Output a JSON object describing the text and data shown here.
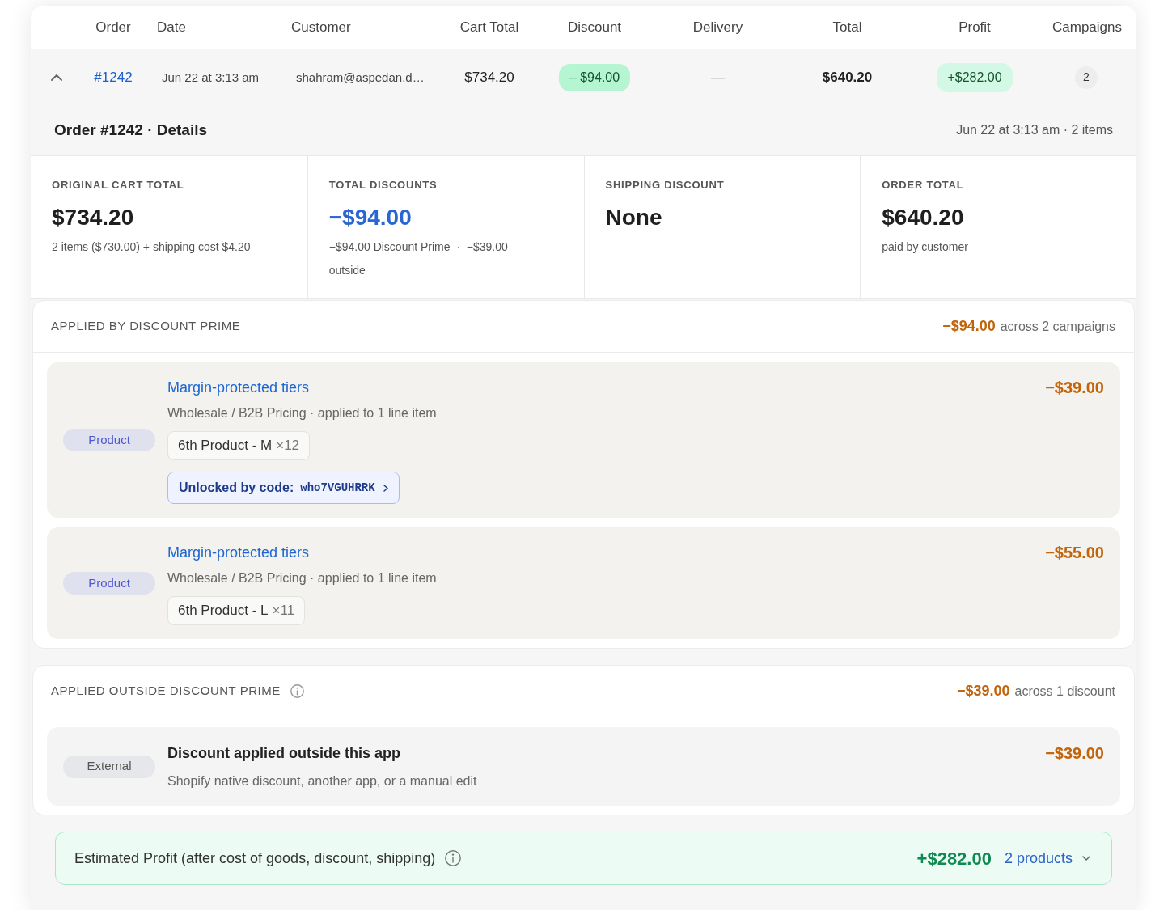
{
  "table": {
    "columns": [
      "Order",
      "Date",
      "Customer",
      "Cart Total",
      "Discount",
      "Delivery",
      "Total",
      "Profit",
      "Campaigns"
    ],
    "row": {
      "expanded": true,
      "order": "#1242",
      "date": "Jun 22 at 3:13 am",
      "customer": "shahram@aspedan.d…",
      "cart_total": "$734.20",
      "discount": "– $94.00",
      "delivery": "—",
      "total": "$640.20",
      "profit": "+$282.00",
      "campaigns": "2"
    }
  },
  "details": {
    "title": "Order #1242 · Details",
    "meta": "Jun 22 at 3:13 am · 2 items"
  },
  "summary": [
    {
      "label": "ORIGINAL CART TOTAL",
      "value": "$734.20",
      "highlight": false,
      "note": "2 items ($730.00) + shipping cost $4.20"
    },
    {
      "label": "TOTAL DISCOUNTS",
      "value": "−$94.00",
      "highlight": true,
      "note": "−$94.00 Discount Prime  ·  −$39.00 outside"
    },
    {
      "label": "SHIPPING DISCOUNT",
      "value": "None",
      "highlight": false
    },
    {
      "label": "ORDER TOTAL",
      "value": "$640.20",
      "highlight": false,
      "note": "paid by customer"
    }
  ],
  "sections": [
    {
      "title": "APPLIED BY DISCOUNT PRIME",
      "info": false,
      "amount": "−$94.00",
      "amount_note": "across 2 campaigns",
      "items": [
        {
          "kind": "campaign",
          "badge": "Product",
          "title": "Margin-protected tiers",
          "subtitle": "Wholesale / B2B Pricing · applied to 1 line item",
          "line_items": [
            {
              "name": "6th Product - M",
              "qty": "×12"
            }
          ],
          "code_label": "Unlocked by code:",
          "code": "who7VGUHRRK",
          "amount": "−$39.00"
        },
        {
          "kind": "campaign",
          "badge": "Product",
          "title": "Margin-protected tiers",
          "subtitle": "Wholesale / B2B Pricing · applied to 1 line item",
          "line_items": [
            {
              "name": "6th Product - L",
              "qty": "×11"
            }
          ],
          "amount": "−$55.00"
        }
      ]
    },
    {
      "title": "APPLIED OUTSIDE DISCOUNT PRIME",
      "info": true,
      "amount": "−$39.00",
      "amount_note": "across 1 discount",
      "items": [
        {
          "kind": "external",
          "badge": "External",
          "title": "Discount applied outside this app",
          "subtitle": "Shopify native discount, another app, or a manual edit",
          "amount": "−$39.00"
        }
      ]
    }
  ],
  "profit": {
    "label": "Estimated Profit (after cost of goods, discount, shipping)",
    "value": "+$282.00",
    "link": "2 products",
    "expanded": false
  }
}
